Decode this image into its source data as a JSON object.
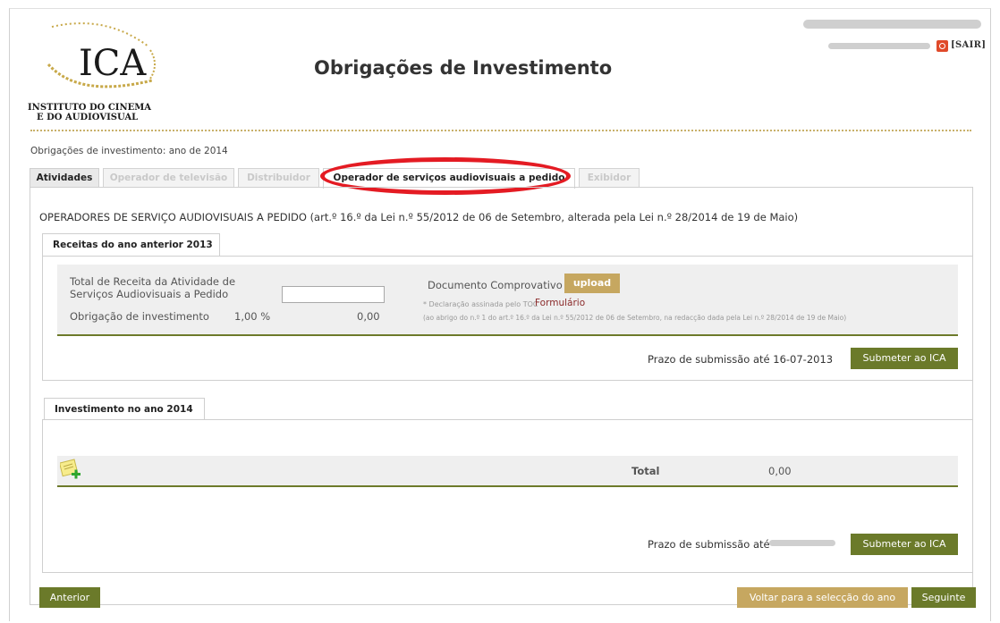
{
  "header": {
    "logo_text": "ICA",
    "org_line1": "INSTITUTO DO CINEMA",
    "org_line2": "E DO AUDIOVISUAL",
    "title": "Obrigações de Investimento",
    "logout_label": "[SAIR]",
    "logout_icon": "power-icon"
  },
  "breadcrumb": "Obrigações de investimento: ano de 2014",
  "tabs": [
    {
      "label": "Atividades",
      "state": "active"
    },
    {
      "label": "Operador de televisão",
      "state": "disabled"
    },
    {
      "label": "Distribuidor",
      "state": "disabled"
    },
    {
      "label": "Operador de serviços audiovisuais a pedido",
      "state": "selected"
    },
    {
      "label": "Exibidor",
      "state": "disabled"
    }
  ],
  "section_heading": "OPERADORES DE SERVIÇO AUDIOVISUAIS A PEDIDO (art.º 16.º da Lei n.º 55/2012 de 06 de Setembro, alterada pela Lei n.º 28/2014 de 19 de Maio)",
  "receitas": {
    "tab_label": "Receitas do ano anterior 2013",
    "total_label_line1": "Total de Receita da Atividade de",
    "total_label_line2": "Serviços Audiovisuais a Pedido",
    "total_value": "",
    "obrigacao_label": "Obrigação de investimento",
    "obrigacao_percent": "1,00 %",
    "obrigacao_value": "0,00",
    "documento_label": "Documento Comprovativo",
    "upload_label": "upload",
    "declaracao_note": "* Declaração assinada pelo TOC",
    "formulario_link": "Formulário",
    "legal_note": "(ao abrigo do n.º 1 do art.º 16.º da Lei n.º 55/2012 de 06 de Setembro, na redacção dada pela Lei n.º 28/2014 de 19 de Maio)",
    "prazo_label": "Prazo de submissão até 16-07-2013",
    "submit_label": "Submeter ao ICA"
  },
  "investimento": {
    "tab_label": "Investimento no ano 2014",
    "add_icon": "add-note-icon",
    "total_label": "Total",
    "total_value": "0,00",
    "prazo_label": "Prazo de submissão até",
    "submit_label": "Submeter ao ICA"
  },
  "footer": {
    "anterior_label": "Anterior",
    "voltar_label": "Voltar para a selecção do ano",
    "seguinte_label": "Seguinte"
  },
  "colors": {
    "olive": "#6b7a2a",
    "gold": "#c6a760",
    "annotation_red": "#e41b23"
  }
}
